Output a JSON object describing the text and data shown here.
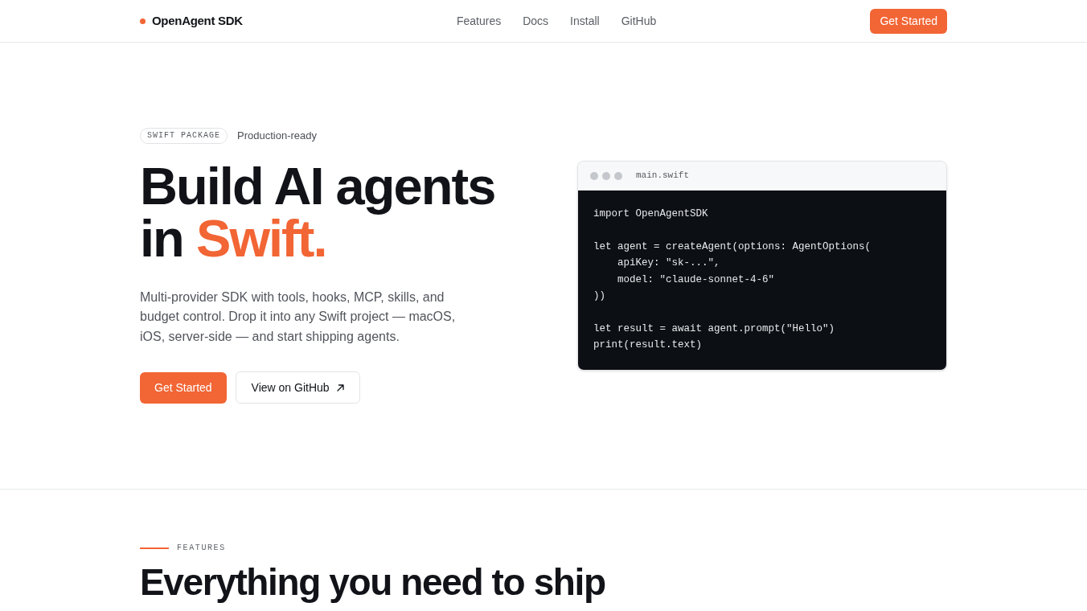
{
  "nav": {
    "brand": "OpenAgent SDK",
    "links": [
      "Features",
      "Docs",
      "Install",
      "GitHub"
    ],
    "cta": "Get Started"
  },
  "hero": {
    "badge": "SWIFT PACKAGE",
    "badge_note": "Production-ready",
    "heading": {
      "text": "Build AI agents in",
      "accent": "Swift."
    },
    "description": "Multi-provider SDK with tools, hooks, MCP, skills, and budget control. Drop it into any Swift project — macOS, iOS, server-side — and start shipping agents.",
    "buttons": [
      {
        "label": "Get Started",
        "kind": "primary"
      },
      {
        "label": "View on GitHub",
        "kind": "external"
      }
    ]
  },
  "code_window": {
    "filename": "main.swift",
    "blocks": [
      [
        "import OpenAgentSDK"
      ],
      [
        "let agent = createAgent(options: AgentOptions(",
        "    apiKey: \"sk-...\",",
        "    model: \"claude-sonnet-4-6\"",
        "))"
      ],
      [
        "let result = await agent.prompt(\"Hello\")",
        "print(result.text)"
      ]
    ]
  },
  "features": {
    "eyebrow": "FEATURES",
    "heading": "Everything you need to ship"
  }
}
